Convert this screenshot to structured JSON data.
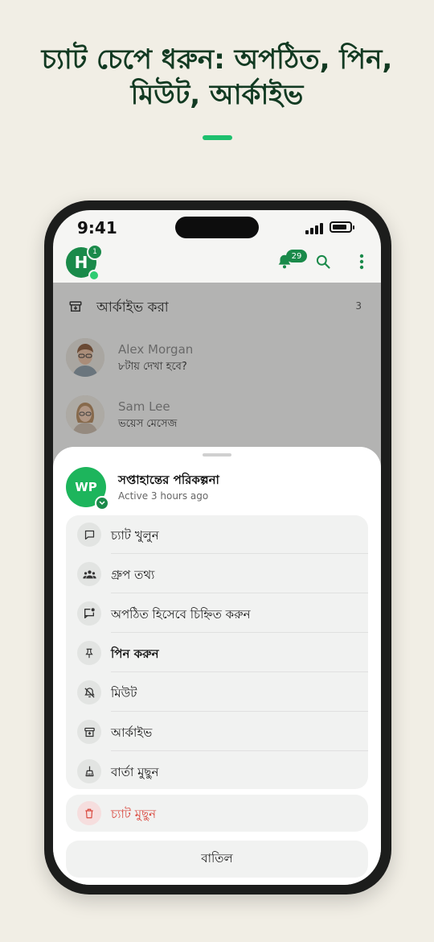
{
  "headline": {
    "line1": "চ্যাট চেপে ধরুন: অপঠিত, পিন,",
    "line2": "মিউট, আর্কাইভ"
  },
  "colors": {
    "background": "#f1eee5",
    "headline": "#123a22",
    "accent": "#1ec06e",
    "brand_green": "#1a8a4a",
    "danger": "#d9473d"
  },
  "status_bar": {
    "time": "9:41"
  },
  "top_bar": {
    "avatar_initial": "H",
    "avatar_badge": "1",
    "notification_count": "29",
    "icons": [
      "bell-icon",
      "search-icon",
      "more-vertical-icon"
    ]
  },
  "archived_row": {
    "label": "আর্কাইভ করা",
    "count": "3"
  },
  "chats": [
    {
      "name": "Alex Morgan",
      "preview": "৮টায় দেখা হবে?"
    },
    {
      "name": "Sam Lee",
      "preview": "ভয়েস মেসেজ"
    }
  ],
  "sheet": {
    "avatar_initials": "WP",
    "title": "সপ্তাহান্তের পরিকল্পনা",
    "status": "Active 3 hours ago",
    "menu": [
      {
        "label": "চ্যাট খুলুন",
        "icon": "chat-bubble-icon"
      },
      {
        "label": "গ্রুপ তথ্য",
        "icon": "group-icon"
      },
      {
        "label": "অপঠিত হিসেবে চিহ্নিত করুন",
        "icon": "mark-unread-icon"
      },
      {
        "label": "পিন করুন",
        "icon": "pin-icon"
      },
      {
        "label": "মিউট",
        "icon": "bell-off-icon"
      },
      {
        "label": "আর্কাইভ",
        "icon": "archive-icon"
      },
      {
        "label": "বার্তা মুছুন",
        "icon": "broom-icon"
      }
    ],
    "delete_label": "চ্যাট মুছুন",
    "cancel_label": "বাতিল"
  }
}
